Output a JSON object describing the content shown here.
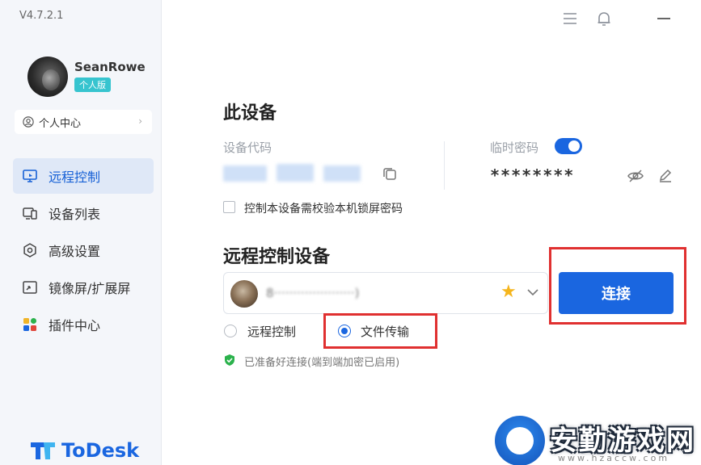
{
  "app": {
    "version": "V4.7.2.1",
    "name": "ToDesk"
  },
  "user": {
    "name": "SeanRowe",
    "plan_badge": "个人版"
  },
  "sidebar": {
    "personal_center": "个人中心",
    "items": [
      {
        "label": "远程控制",
        "icon": "monitor-icon",
        "active": true
      },
      {
        "label": "设备列表",
        "icon": "devices-icon",
        "active": false
      },
      {
        "label": "高级设置",
        "icon": "settings-icon",
        "active": false
      },
      {
        "label": "镜像屏/扩展屏",
        "icon": "mirror-screen-icon",
        "active": false
      },
      {
        "label": "插件中心",
        "icon": "plugins-icon",
        "active": false
      }
    ]
  },
  "this_device": {
    "title": "此设备",
    "device_code_label": "设备代码",
    "temp_password_label": "临时密码",
    "temp_password_enabled": true,
    "temp_password_value": "********",
    "lock_screen_check_label": "控制本设备需校验本机锁屏密码",
    "lock_screen_checked": false
  },
  "remote_control": {
    "title": "远程控制设备",
    "connect_label": "连接",
    "mode_options": [
      "远程控制",
      "文件传输"
    ],
    "selected_mode": "文件传输",
    "status_text": "已准备好连接(端到端加密已启用)"
  },
  "watermark": {
    "text": "安勤游戏网",
    "url": "www.hzaccw.com"
  },
  "colors": {
    "accent": "#1a66e0",
    "highlight_border": "#e03030",
    "active_nav_bg": "#dfe8f7",
    "status_ok": "#2bb24c"
  }
}
